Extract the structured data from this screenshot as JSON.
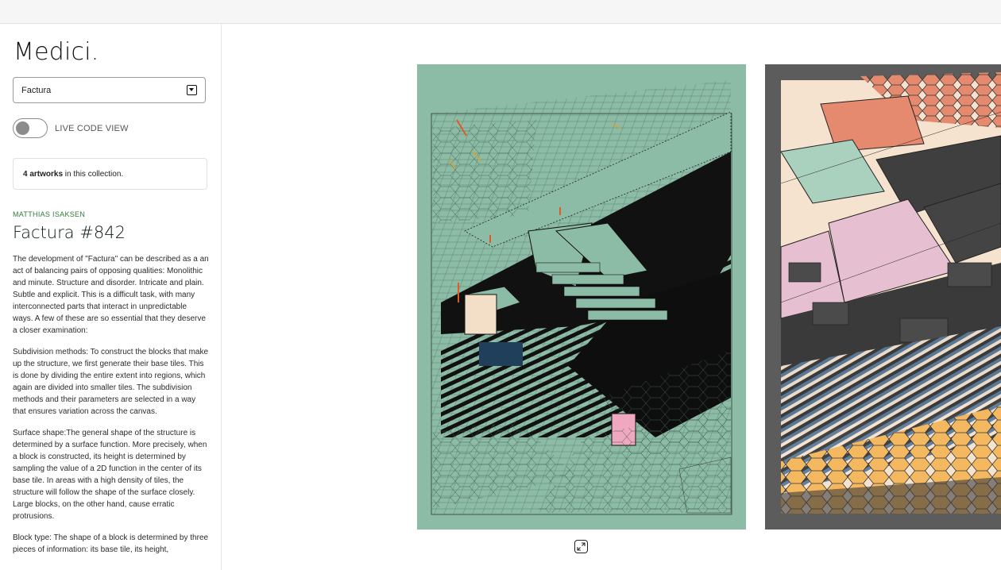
{
  "sidebar": {
    "brand": "Medici.",
    "collection_select": {
      "selected": "Factura"
    },
    "live_code": {
      "label": "LIVE CODE VIEW",
      "enabled": false
    },
    "count": {
      "number": "4 artworks",
      "suffix": " in this collection."
    },
    "artwork": {
      "artist": "MATTHIAS ISAKSEN",
      "title": "Factura #842",
      "description": [
        "The development of \"Factura\" can be described as a an act of balancing pairs of opposing qualities: Monolithic and minute. Structure and disorder. Intricate and plain. Subtle and explicit. This is a difficult task, with many interconnected parts that interact in unpredictable ways. A few of these are so essential that they deserve a closer examination:",
        "Subdivision methods: To construct the blocks that make up the structure, we first generate their base tiles. This is done by dividing the entire extent into regions, which again are divided into smaller tiles. The subdivision methods and their parameters are selected in a way that ensures variation across the canvas.",
        "Surface shape:The general shape of the structure is determined by a surface function. More precisely, when a block is constructed, its height is determined by sampling the value of a 2D function in the center of its base tile. In areas with a high density of tiles, the structure will follow the shape of the surface closely. Large blocks, on the other hand, cause erratic protrusions.",
        "Block type: The shape of a block is determined by three pieces of information: its base tile, its height,"
      ]
    }
  },
  "gallery": {
    "artwork_1": {
      "background": "#8dbca6"
    },
    "artwork_2": {
      "background": "#5c5c5c"
    },
    "expand_icon": "expand-icon"
  },
  "colors": {
    "accent_green": "#2f7a3a",
    "mint": "#8dbca6",
    "salmon": "#e58a6f",
    "pink": "#e6bfd0",
    "cream": "#f5e3cf",
    "orange": "#f4b860",
    "slate_blue": "#5a7a9a"
  }
}
